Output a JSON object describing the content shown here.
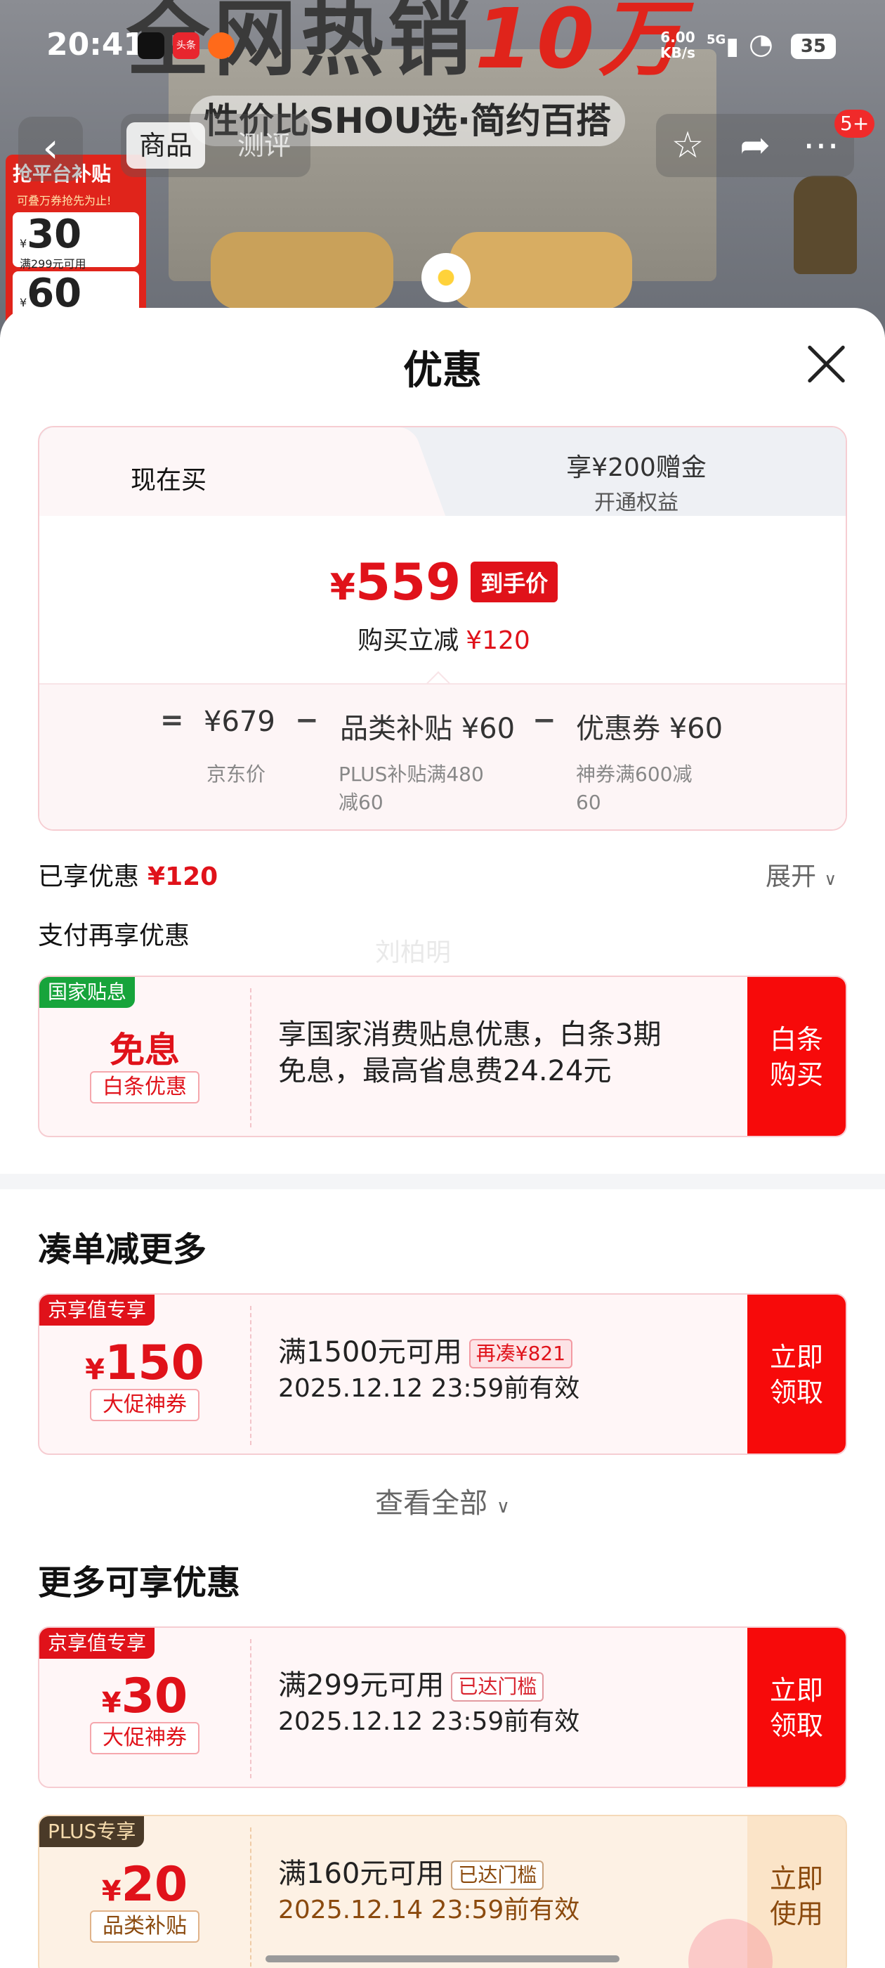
{
  "status_bar": {
    "time": "20:41",
    "net_speed_value": "6.00",
    "net_speed_unit": "KB/s",
    "signal": "5G",
    "battery": "35",
    "app_badge": "头条"
  },
  "background": {
    "banner_text": "全网热销",
    "banner_number": "10万",
    "slogan": "性价比SHOU选·简约百搭",
    "sticker_title": "抢平台补贴",
    "sticker_sub": "可叠万券抢先为止!",
    "sticker_coupon1_value": "30",
    "sticker_coupon1_cond": "满299元可用",
    "sticker_coupon2_value": "60"
  },
  "nav": {
    "tab_product": "商品",
    "tab_review": "测评",
    "badge": "5+"
  },
  "sheet": {
    "title": "优惠"
  },
  "price_panel": {
    "tab_buy_now": "现在买",
    "tab_gift_line1": "享¥200赠金",
    "tab_gift_line2": "开通权益",
    "currency": "¥",
    "final_price": "559",
    "final_tag": "到手价",
    "reduce_label": "购买立减",
    "reduce_value": "¥120",
    "eq": "=",
    "minus": "−",
    "jd_price": "¥679",
    "jd_price_label": "京东价",
    "subsidy": "品类补贴 ¥60",
    "subsidy_label_1": "PLUS补贴满480",
    "subsidy_label_2": "减60",
    "coupon": "优惠券 ¥60",
    "coupon_label_1": "神券满600减",
    "coupon_label_2": "60"
  },
  "enjoyed": {
    "label": "已享优惠",
    "value": "¥120",
    "expand": "展开"
  },
  "pay_more": {
    "title": "支付再享优惠",
    "watermark": "刘柏明",
    "card": {
      "corner": "国家贴息",
      "main": "免息",
      "tag": "白条优惠",
      "line1": "享国家消费贴息优惠，白条3期",
      "line2": "免息，最高省息费24.24元",
      "btn_l1": "白条",
      "btn_l2": "购买"
    }
  },
  "bundle": {
    "title": "凑单减更多",
    "card": {
      "corner": "京享值专享",
      "currency": "¥",
      "amount": "150",
      "tag": "大促神券",
      "line1": "满1500元可用",
      "pill": "再凑¥821",
      "line2": "2025.12.12 23:59前有效",
      "btn_l1": "立即",
      "btn_l2": "领取"
    },
    "see_all": "查看全部"
  },
  "more": {
    "title": "更多可享优惠",
    "cards": [
      {
        "corner": "京享值专享",
        "currency": "¥",
        "amount": "30",
        "tag": "大促神券",
        "line1": "满299元可用",
        "pill": "已达门槛",
        "line2": "2025.12.12 23:59前有效",
        "btn_l1": "立即",
        "btn_l2": "领取"
      },
      {
        "corner": "PLUS专享",
        "currency": "¥",
        "amount": "20",
        "tag": "品类补贴",
        "line1": "满160元可用",
        "pill": "已达门槛",
        "line2": "2025.12.14 23:59前有效",
        "btn_l1": "立即",
        "btn_l2": "使用"
      }
    ]
  },
  "colors": {
    "accent_red": "#e0121a",
    "button_red": "#f70a0a",
    "panel_border": "#f6cdd2",
    "plus_bg": "#fdf1e4"
  }
}
